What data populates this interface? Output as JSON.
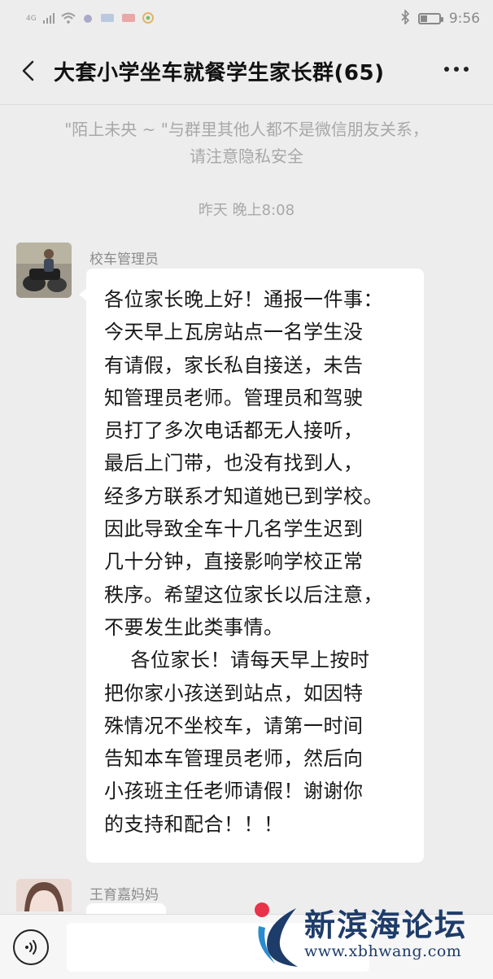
{
  "status_bar": {
    "network_label": "4G",
    "time": "9:56",
    "battery_level": 0.35
  },
  "header": {
    "title": "大套小学坐车就餐学生家长群(65)"
  },
  "notice": {
    "line1": "\"陌上未央 ~ \"与群里其他人都不是微信朋友关系，",
    "line2": "请注意隐私安全"
  },
  "timestamp": "昨天 晚上8:08",
  "messages": [
    {
      "sender": "校车管理员",
      "lines": [
        "各位家长晚上好！通报一件事：",
        "今天早上瓦房站点一名学生没",
        "有请假，家长私自接送，未告",
        "知管理员老师。管理员和驾驶",
        "员打了多次电话都无人接听，",
        "最后上门带，也没有找到人，",
        "经多方联系才知道她已到学校。",
        "因此导致全车十几名学生迟到",
        "几十分钟，直接影响学校正常",
        "秩序。希望这位家长以后注意，",
        "不要发生此类事情。",
        "    各位家长！请每天早上按时",
        "把你家小孩送到站点，如因特",
        "殊情况不坐校车，请第一时间",
        "告知本车管理员老师，然后向",
        "小孩班主任老师请假！谢谢你",
        "的支持和配合！！！"
      ]
    },
    {
      "sender": "王育嘉妈妈"
    }
  ],
  "watermark": {
    "title": "新滨海论坛",
    "url": "www.xbhwang.com"
  },
  "colors": {
    "background": "#ededed",
    "bubble": "#ffffff",
    "watermark": "#1e3c6a",
    "watermark_accent": "#e8334a"
  }
}
